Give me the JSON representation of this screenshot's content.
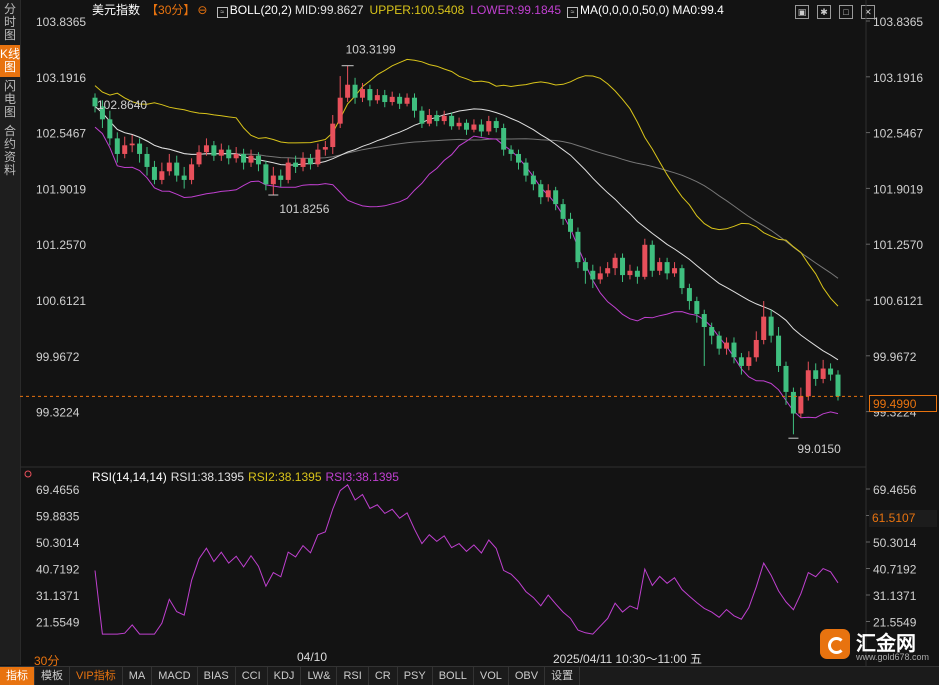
{
  "sidebar": {
    "tabs": [
      "分时图",
      "K线图",
      "闪电图",
      "合约资料"
    ],
    "active_index": 1
  },
  "header": {
    "symbol": "美元指数",
    "period": "【30分】",
    "period_icon": "settings-circle-icon",
    "boll_label": "BOLL(20,2)",
    "mid": "MID:99.8627",
    "upper": "UPPER:100.5408",
    "lower": "LOWER:99.1845",
    "ma_label": "MA(0,0,0,0,50,0)",
    "ma_value": "MA0:99.4"
  },
  "window_icons": [
    "screenshot-icon",
    "settings-icon",
    "maximize-icon",
    "close-icon"
  ],
  "rsi_header": {
    "label": "RSI(14,14,14)",
    "rsi1": "RSI1:38.1395",
    "rsi2": "RSI2:38.1395",
    "rsi3": "RSI3:38.1395"
  },
  "price_axis": [
    "103.8365",
    "103.1916",
    "102.5467",
    "101.9019",
    "101.2570",
    "100.6121",
    "99.9672",
    "99.3224"
  ],
  "rsi_axis": [
    "69.4656",
    "59.8835",
    "50.3014",
    "40.7192",
    "31.1371",
    "21.5549"
  ],
  "current_price": "99.4990",
  "current_rsi": "61.5107",
  "annotations": {
    "high": "103.3199",
    "left_start": "102.8640",
    "low1": "101.8256",
    "low2": "99.0150"
  },
  "bottom": {
    "period": "30分",
    "date": "04/10",
    "time": "2025/04/11 10:30～11:00 五",
    "tabs": [
      "指标",
      "模板",
      "VIP指标",
      "MA",
      "MACD",
      "BIAS",
      "CCI",
      "KDJ",
      "LW&",
      "RSI",
      "CR",
      "PSY",
      "BOLL",
      "VOL",
      "OBV",
      "设置"
    ],
    "active_index": 0
  },
  "logo": {
    "name": "汇金网",
    "url": "www.gold678.com"
  },
  "colors": {
    "up": "#e8505b",
    "down": "#3fbf7f",
    "mid": "#e0e0e0",
    "upper": "#d9c41a",
    "lower": "#c040d0",
    "ma": "#777777",
    "rsi": "#c040d0",
    "accent": "#e8730f"
  },
  "chart_data": [
    {
      "type": "candlestick",
      "ylim": [
        99.0,
        103.85
      ],
      "candles": [
        [
          102.95,
          102.85,
          103.0,
          102.78
        ],
        [
          102.85,
          102.7,
          102.92,
          102.6
        ],
        [
          102.7,
          102.48,
          102.8,
          102.4
        ],
        [
          102.48,
          102.3,
          102.55,
          102.2
        ],
        [
          102.3,
          102.4,
          102.5,
          102.25
        ],
        [
          102.4,
          102.42,
          102.52,
          102.32
        ],
        [
          102.42,
          102.3,
          102.48,
          102.2
        ],
        [
          102.3,
          102.15,
          102.38,
          102.05
        ],
        [
          102.15,
          102.0,
          102.22,
          101.95
        ],
        [
          102.0,
          102.1,
          102.2,
          101.95
        ],
        [
          102.1,
          102.2,
          102.3,
          102.05
        ],
        [
          102.2,
          102.05,
          102.28,
          101.98
        ],
        [
          102.05,
          102.0,
          102.15,
          101.9
        ],
        [
          102.0,
          102.18,
          102.25,
          101.95
        ],
        [
          102.18,
          102.32,
          102.4,
          102.15
        ],
        [
          102.32,
          102.4,
          102.48,
          102.28
        ],
        [
          102.4,
          102.28,
          102.45,
          102.22
        ],
        [
          102.28,
          102.35,
          102.42,
          102.22
        ],
        [
          102.35,
          102.25,
          102.4,
          102.18
        ],
        [
          102.25,
          102.3,
          102.38,
          102.2
        ],
        [
          102.3,
          102.2,
          102.36,
          102.12
        ],
        [
          102.2,
          102.28,
          102.35,
          102.15
        ],
        [
          102.28,
          102.18,
          102.32,
          102.1
        ],
        [
          102.18,
          101.95,
          102.22,
          101.88
        ],
        [
          101.95,
          102.05,
          102.15,
          101.82
        ],
        [
          102.05,
          102.0,
          102.12,
          101.92
        ],
        [
          102.0,
          102.2,
          102.25,
          101.96
        ],
        [
          102.2,
          102.15,
          102.28,
          102.08
        ],
        [
          102.15,
          102.25,
          102.32,
          102.1
        ],
        [
          102.25,
          102.18,
          102.3,
          102.12
        ],
        [
          102.18,
          102.35,
          102.42,
          102.15
        ],
        [
          102.35,
          102.38,
          102.45,
          102.28
        ],
        [
          102.38,
          102.65,
          102.75,
          102.3
        ],
        [
          102.65,
          102.95,
          103.2,
          102.6
        ],
        [
          102.95,
          103.1,
          103.32,
          102.9
        ],
        [
          103.1,
          102.95,
          103.18,
          102.88
        ],
        [
          102.95,
          103.05,
          103.12,
          102.9
        ],
        [
          103.05,
          102.92,
          103.1,
          102.85
        ],
        [
          102.92,
          102.98,
          103.05,
          102.88
        ],
        [
          102.98,
          102.9,
          103.04,
          102.84
        ],
        [
          102.9,
          102.96,
          103.02,
          102.86
        ],
        [
          102.96,
          102.88,
          103.0,
          102.82
        ],
        [
          102.88,
          102.95,
          103.0,
          102.85
        ],
        [
          102.95,
          102.8,
          103.0,
          102.72
        ],
        [
          102.8,
          102.65,
          102.85,
          102.6
        ],
        [
          102.65,
          102.75,
          102.82,
          102.62
        ],
        [
          102.75,
          102.68,
          102.8,
          102.62
        ],
        [
          102.68,
          102.74,
          102.8,
          102.64
        ],
        [
          102.74,
          102.62,
          102.78,
          102.58
        ],
        [
          102.62,
          102.66,
          102.72,
          102.58
        ],
        [
          102.66,
          102.58,
          102.7,
          102.52
        ],
        [
          102.58,
          102.64,
          102.7,
          102.55
        ],
        [
          102.64,
          102.56,
          102.7,
          102.5
        ],
        [
          102.56,
          102.68,
          102.74,
          102.52
        ],
        [
          102.68,
          102.6,
          102.72,
          102.55
        ],
        [
          102.6,
          102.35,
          102.65,
          102.28
        ],
        [
          102.35,
          102.3,
          102.4,
          102.22
        ],
        [
          102.3,
          102.2,
          102.35,
          102.12
        ],
        [
          102.2,
          102.05,
          102.25,
          101.98
        ],
        [
          102.05,
          101.95,
          102.1,
          101.88
        ],
        [
          101.95,
          101.8,
          102.0,
          101.72
        ],
        [
          101.8,
          101.88,
          101.95,
          101.75
        ],
        [
          101.88,
          101.72,
          101.92,
          101.65
        ],
        [
          101.72,
          101.55,
          101.78,
          101.48
        ],
        [
          101.55,
          101.4,
          101.62,
          101.32
        ],
        [
          101.4,
          101.05,
          101.45,
          100.98
        ],
        [
          101.05,
          100.95,
          101.1,
          100.8
        ],
        [
          100.95,
          100.85,
          101.02,
          100.75
        ],
        [
          100.85,
          100.92,
          101.0,
          100.8
        ],
        [
          100.92,
          100.98,
          101.05,
          100.88
        ],
        [
          100.98,
          101.1,
          101.15,
          100.9
        ],
        [
          101.1,
          100.9,
          101.15,
          100.82
        ],
        [
          100.9,
          100.95,
          101.02,
          100.85
        ],
        [
          100.95,
          100.88,
          101.0,
          100.8
        ],
        [
          100.88,
          101.25,
          101.32,
          100.85
        ],
        [
          101.25,
          100.95,
          101.3,
          100.88
        ],
        [
          100.95,
          101.05,
          101.1,
          100.9
        ],
        [
          101.05,
          100.92,
          101.1,
          100.85
        ],
        [
          100.92,
          100.98,
          101.05,
          100.88
        ],
        [
          100.98,
          100.75,
          101.02,
          100.68
        ],
        [
          100.75,
          100.6,
          100.8,
          100.5
        ],
        [
          100.6,
          100.45,
          100.65,
          100.35
        ],
        [
          100.45,
          100.3,
          100.5,
          99.85
        ],
        [
          100.3,
          100.2,
          100.35,
          100.1
        ],
        [
          100.2,
          100.05,
          100.25,
          99.98
        ],
        [
          100.05,
          100.12,
          100.18,
          99.98
        ],
        [
          100.12,
          99.95,
          100.18,
          99.88
        ],
        [
          99.95,
          99.85,
          100.0,
          99.75
        ],
        [
          99.85,
          99.95,
          100.02,
          99.8
        ],
        [
          99.95,
          100.15,
          100.25,
          99.9
        ],
        [
          100.15,
          100.42,
          100.6,
          100.1
        ],
        [
          100.42,
          100.2,
          100.5,
          100.12
        ],
        [
          100.2,
          99.85,
          100.3,
          99.78
        ],
        [
          99.85,
          99.55,
          99.9,
          99.4
        ],
        [
          99.55,
          99.3,
          99.6,
          99.06
        ],
        [
          99.3,
          99.5,
          99.6,
          99.25
        ],
        [
          99.5,
          99.8,
          99.9,
          99.45
        ],
        [
          99.8,
          99.7,
          99.88,
          99.62
        ],
        [
          99.7,
          99.82,
          99.92,
          99.65
        ],
        [
          99.82,
          99.75,
          99.88,
          99.68
        ],
        [
          99.75,
          99.5,
          99.8,
          99.45
        ]
      ]
    },
    {
      "type": "line",
      "name": "RSI1",
      "ylim": [
        16,
        74
      ]
    }
  ]
}
